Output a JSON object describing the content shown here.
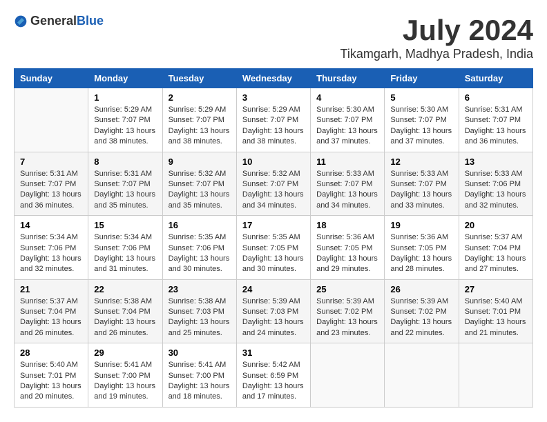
{
  "header": {
    "logo_general": "General",
    "logo_blue": "Blue",
    "month_year": "July 2024",
    "location": "Tikamgarh, Madhya Pradesh, India"
  },
  "days_of_week": [
    "Sunday",
    "Monday",
    "Tuesday",
    "Wednesday",
    "Thursday",
    "Friday",
    "Saturday"
  ],
  "weeks": [
    [
      {
        "day": "",
        "sunrise": "",
        "sunset": "",
        "daylight": ""
      },
      {
        "day": "1",
        "sunrise": "Sunrise: 5:29 AM",
        "sunset": "Sunset: 7:07 PM",
        "daylight": "Daylight: 13 hours and 38 minutes."
      },
      {
        "day": "2",
        "sunrise": "Sunrise: 5:29 AM",
        "sunset": "Sunset: 7:07 PM",
        "daylight": "Daylight: 13 hours and 38 minutes."
      },
      {
        "day": "3",
        "sunrise": "Sunrise: 5:29 AM",
        "sunset": "Sunset: 7:07 PM",
        "daylight": "Daylight: 13 hours and 38 minutes."
      },
      {
        "day": "4",
        "sunrise": "Sunrise: 5:30 AM",
        "sunset": "Sunset: 7:07 PM",
        "daylight": "Daylight: 13 hours and 37 minutes."
      },
      {
        "day": "5",
        "sunrise": "Sunrise: 5:30 AM",
        "sunset": "Sunset: 7:07 PM",
        "daylight": "Daylight: 13 hours and 37 minutes."
      },
      {
        "day": "6",
        "sunrise": "Sunrise: 5:31 AM",
        "sunset": "Sunset: 7:07 PM",
        "daylight": "Daylight: 13 hours and 36 minutes."
      }
    ],
    [
      {
        "day": "7",
        "sunrise": "Sunrise: 5:31 AM",
        "sunset": "Sunset: 7:07 PM",
        "daylight": "Daylight: 13 hours and 36 minutes."
      },
      {
        "day": "8",
        "sunrise": "Sunrise: 5:31 AM",
        "sunset": "Sunset: 7:07 PM",
        "daylight": "Daylight: 13 hours and 35 minutes."
      },
      {
        "day": "9",
        "sunrise": "Sunrise: 5:32 AM",
        "sunset": "Sunset: 7:07 PM",
        "daylight": "Daylight: 13 hours and 35 minutes."
      },
      {
        "day": "10",
        "sunrise": "Sunrise: 5:32 AM",
        "sunset": "Sunset: 7:07 PM",
        "daylight": "Daylight: 13 hours and 34 minutes."
      },
      {
        "day": "11",
        "sunrise": "Sunrise: 5:33 AM",
        "sunset": "Sunset: 7:07 PM",
        "daylight": "Daylight: 13 hours and 34 minutes."
      },
      {
        "day": "12",
        "sunrise": "Sunrise: 5:33 AM",
        "sunset": "Sunset: 7:07 PM",
        "daylight": "Daylight: 13 hours and 33 minutes."
      },
      {
        "day": "13",
        "sunrise": "Sunrise: 5:33 AM",
        "sunset": "Sunset: 7:06 PM",
        "daylight": "Daylight: 13 hours and 32 minutes."
      }
    ],
    [
      {
        "day": "14",
        "sunrise": "Sunrise: 5:34 AM",
        "sunset": "Sunset: 7:06 PM",
        "daylight": "Daylight: 13 hours and 32 minutes."
      },
      {
        "day": "15",
        "sunrise": "Sunrise: 5:34 AM",
        "sunset": "Sunset: 7:06 PM",
        "daylight": "Daylight: 13 hours and 31 minutes."
      },
      {
        "day": "16",
        "sunrise": "Sunrise: 5:35 AM",
        "sunset": "Sunset: 7:06 PM",
        "daylight": "Daylight: 13 hours and 30 minutes."
      },
      {
        "day": "17",
        "sunrise": "Sunrise: 5:35 AM",
        "sunset": "Sunset: 7:05 PM",
        "daylight": "Daylight: 13 hours and 30 minutes."
      },
      {
        "day": "18",
        "sunrise": "Sunrise: 5:36 AM",
        "sunset": "Sunset: 7:05 PM",
        "daylight": "Daylight: 13 hours and 29 minutes."
      },
      {
        "day": "19",
        "sunrise": "Sunrise: 5:36 AM",
        "sunset": "Sunset: 7:05 PM",
        "daylight": "Daylight: 13 hours and 28 minutes."
      },
      {
        "day": "20",
        "sunrise": "Sunrise: 5:37 AM",
        "sunset": "Sunset: 7:04 PM",
        "daylight": "Daylight: 13 hours and 27 minutes."
      }
    ],
    [
      {
        "day": "21",
        "sunrise": "Sunrise: 5:37 AM",
        "sunset": "Sunset: 7:04 PM",
        "daylight": "Daylight: 13 hours and 26 minutes."
      },
      {
        "day": "22",
        "sunrise": "Sunrise: 5:38 AM",
        "sunset": "Sunset: 7:04 PM",
        "daylight": "Daylight: 13 hours and 26 minutes."
      },
      {
        "day": "23",
        "sunrise": "Sunrise: 5:38 AM",
        "sunset": "Sunset: 7:03 PM",
        "daylight": "Daylight: 13 hours and 25 minutes."
      },
      {
        "day": "24",
        "sunrise": "Sunrise: 5:39 AM",
        "sunset": "Sunset: 7:03 PM",
        "daylight": "Daylight: 13 hours and 24 minutes."
      },
      {
        "day": "25",
        "sunrise": "Sunrise: 5:39 AM",
        "sunset": "Sunset: 7:02 PM",
        "daylight": "Daylight: 13 hours and 23 minutes."
      },
      {
        "day": "26",
        "sunrise": "Sunrise: 5:39 AM",
        "sunset": "Sunset: 7:02 PM",
        "daylight": "Daylight: 13 hours and 22 minutes."
      },
      {
        "day": "27",
        "sunrise": "Sunrise: 5:40 AM",
        "sunset": "Sunset: 7:01 PM",
        "daylight": "Daylight: 13 hours and 21 minutes."
      }
    ],
    [
      {
        "day": "28",
        "sunrise": "Sunrise: 5:40 AM",
        "sunset": "Sunset: 7:01 PM",
        "daylight": "Daylight: 13 hours and 20 minutes."
      },
      {
        "day": "29",
        "sunrise": "Sunrise: 5:41 AM",
        "sunset": "Sunset: 7:00 PM",
        "daylight": "Daylight: 13 hours and 19 minutes."
      },
      {
        "day": "30",
        "sunrise": "Sunrise: 5:41 AM",
        "sunset": "Sunset: 7:00 PM",
        "daylight": "Daylight: 13 hours and 18 minutes."
      },
      {
        "day": "31",
        "sunrise": "Sunrise: 5:42 AM",
        "sunset": "Sunset: 6:59 PM",
        "daylight": "Daylight: 13 hours and 17 minutes."
      },
      {
        "day": "",
        "sunrise": "",
        "sunset": "",
        "daylight": ""
      },
      {
        "day": "",
        "sunrise": "",
        "sunset": "",
        "daylight": ""
      },
      {
        "day": "",
        "sunrise": "",
        "sunset": "",
        "daylight": ""
      }
    ]
  ]
}
